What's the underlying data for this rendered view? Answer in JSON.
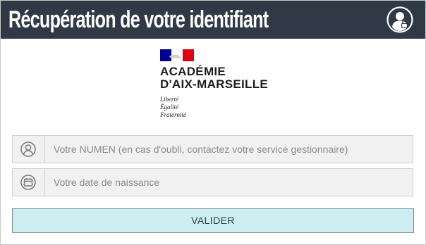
{
  "header": {
    "title": "Récupération de votre identifiant",
    "user_icon": "user-lock-icon"
  },
  "logo": {
    "line1": "ACADÉMIE",
    "line2": "D'AIX-MARSEILLE",
    "motto1": "Liberté",
    "motto2": "Égalité",
    "motto3": "Fraternité",
    "flag_colors": [
      "#000091",
      "#ffffff",
      "#e1000f"
    ]
  },
  "form": {
    "numen": {
      "icon": "user-icon",
      "placeholder": "Votre NUMEN (en cas d'oubli, contactez votre service gestionnaire)",
      "value": ""
    },
    "birthdate": {
      "icon": "calendar-icon",
      "placeholder": "Votre date de naissance",
      "value": ""
    },
    "submit_label": "VALIDER"
  },
  "colors": {
    "header_bg": "#2f3a46",
    "button_bg": "#cdeef1",
    "field_bg": "#f1f1f1"
  }
}
